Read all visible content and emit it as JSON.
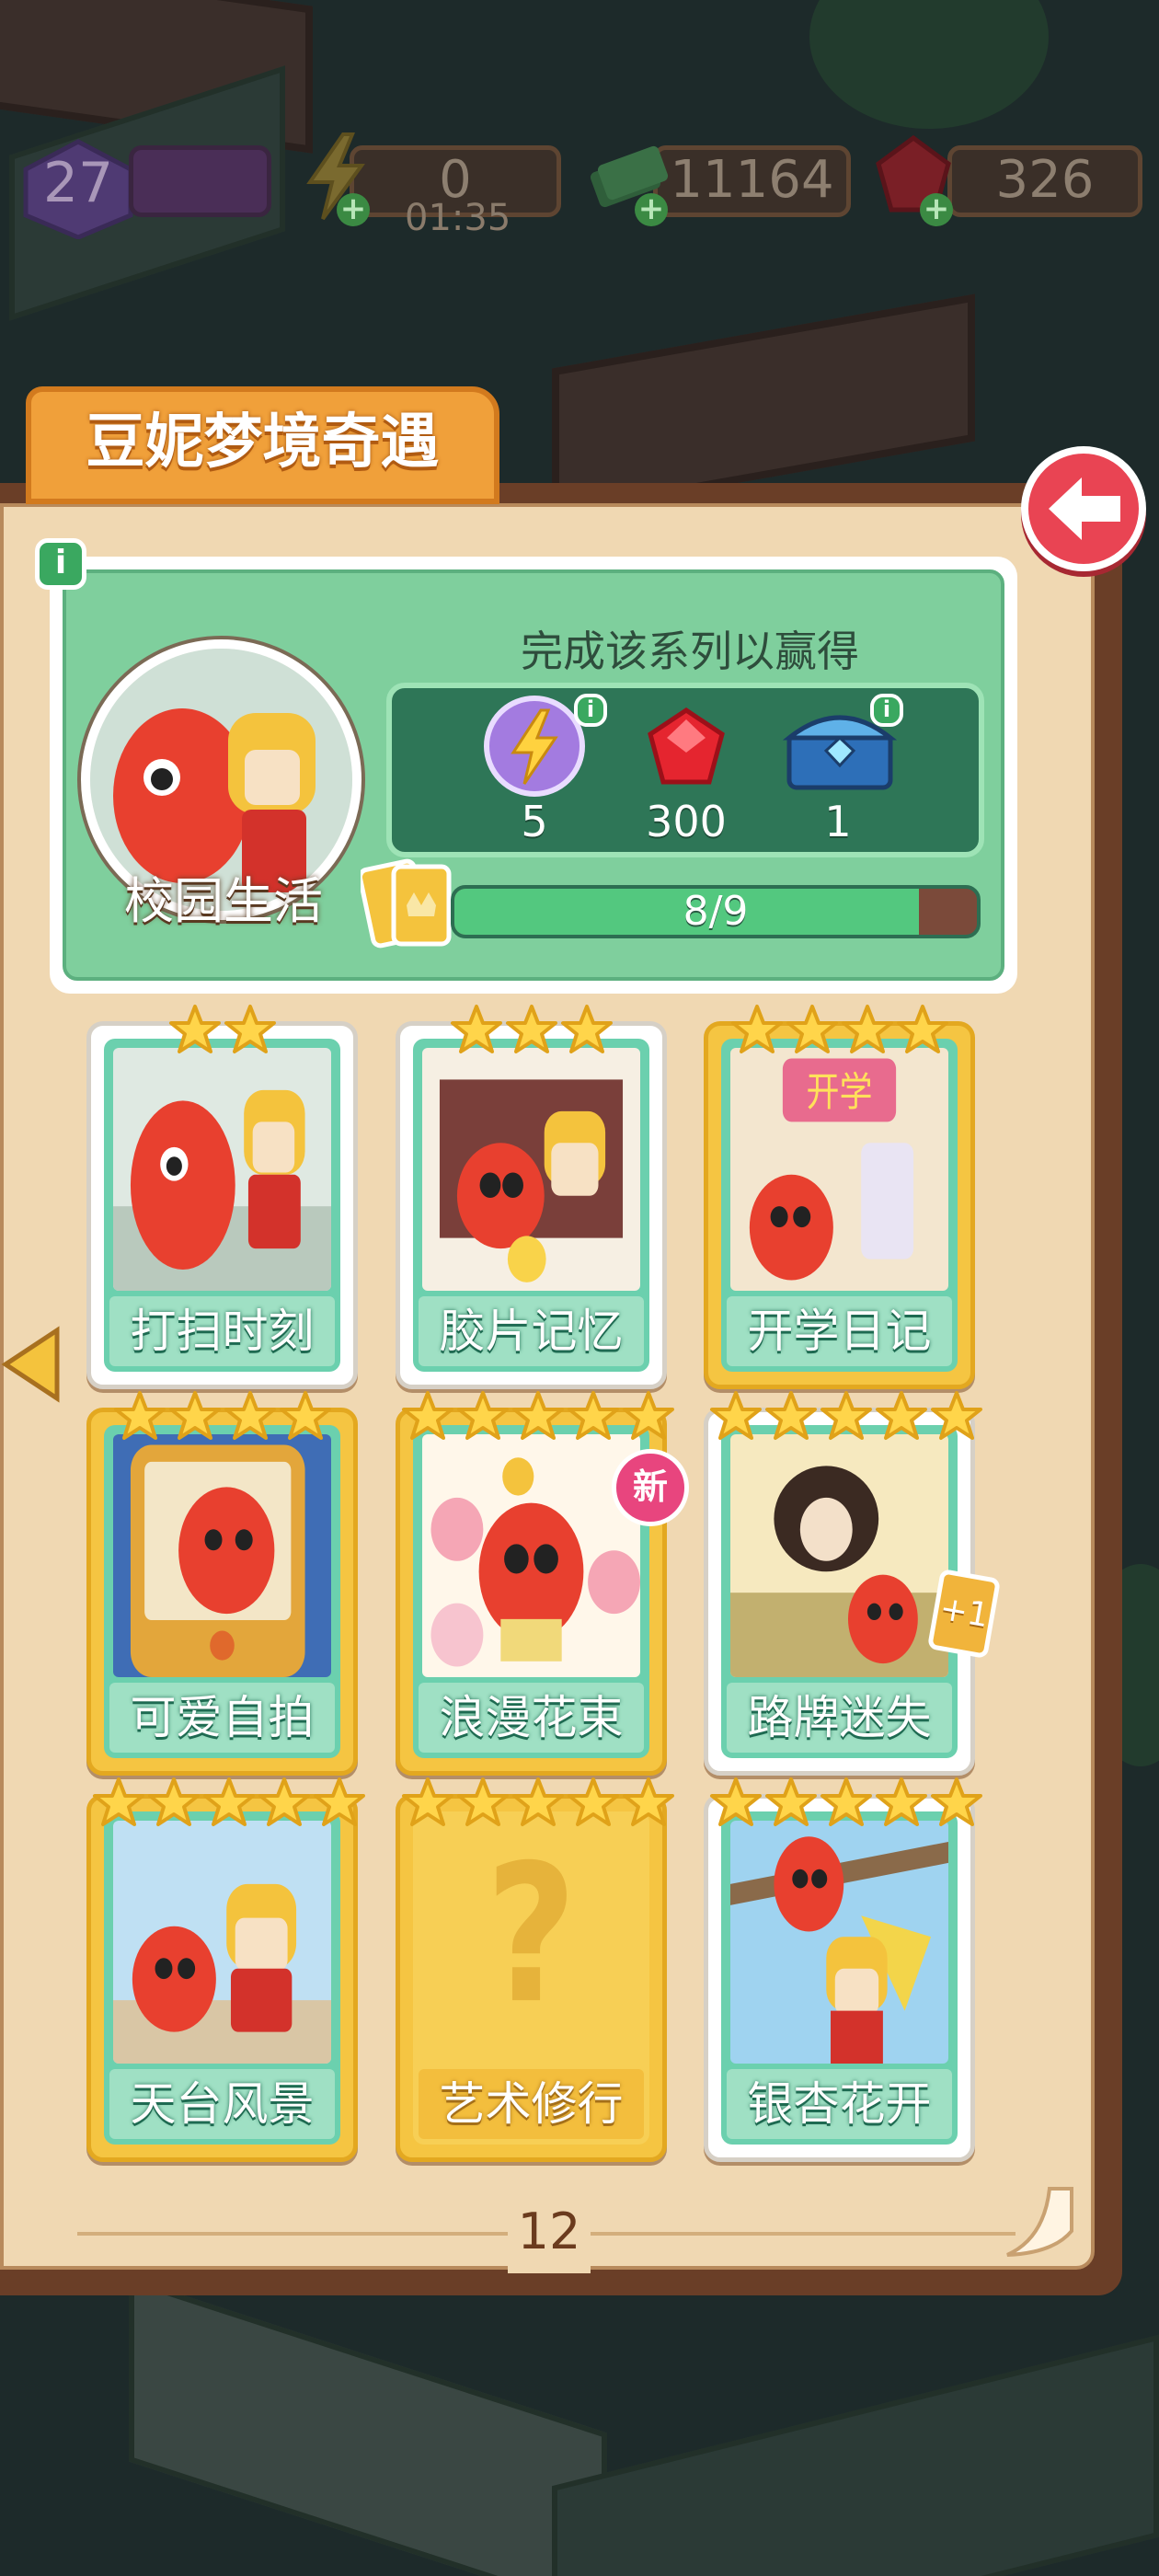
{
  "hud": {
    "level": "27",
    "energy": "0",
    "energy_timer": "01:35",
    "cash": "11164",
    "gems": "326"
  },
  "panel": {
    "title": "豆妮梦境奇遇",
    "page_number": "12"
  },
  "series": {
    "name": "校园生活",
    "reward_title": "完成该系列以赢得",
    "rewards": [
      {
        "icon": "energy-orb-icon",
        "qty": "5"
      },
      {
        "icon": "ruby-icon",
        "qty": "300"
      },
      {
        "icon": "treasure-chest-icon",
        "qty": "1"
      }
    ],
    "progress_text": "8/9",
    "progress_fraction": 0.889
  },
  "cards": [
    {
      "label": "打扫时刻",
      "stars": 2,
      "rarity": "white",
      "locked": false
    },
    {
      "label": "胶片记忆",
      "stars": 3,
      "rarity": "white",
      "locked": false
    },
    {
      "label": "开学日记",
      "stars": 4,
      "rarity": "gold",
      "locked": false
    },
    {
      "label": "可爱自拍",
      "stars": 4,
      "rarity": "gold",
      "locked": false
    },
    {
      "label": "浪漫花束",
      "stars": 5,
      "rarity": "gold",
      "locked": false,
      "badge": "新"
    },
    {
      "label": "路牌迷失",
      "stars": 5,
      "rarity": "white",
      "locked": false,
      "badge": "+1"
    },
    {
      "label": "天台风景",
      "stars": 5,
      "rarity": "gold",
      "locked": false
    },
    {
      "label": "艺术修行",
      "stars": 5,
      "rarity": "gold",
      "locked": true
    },
    {
      "label": "银杏花开",
      "stars": 5,
      "rarity": "white",
      "locked": false
    }
  ],
  "colors": {
    "accent_orange": "#f0a03a",
    "back_button_red": "#e94453",
    "card_teal": "#6bd0ae",
    "gold_card": "#f5c542",
    "progress_green": "#53c87f"
  }
}
